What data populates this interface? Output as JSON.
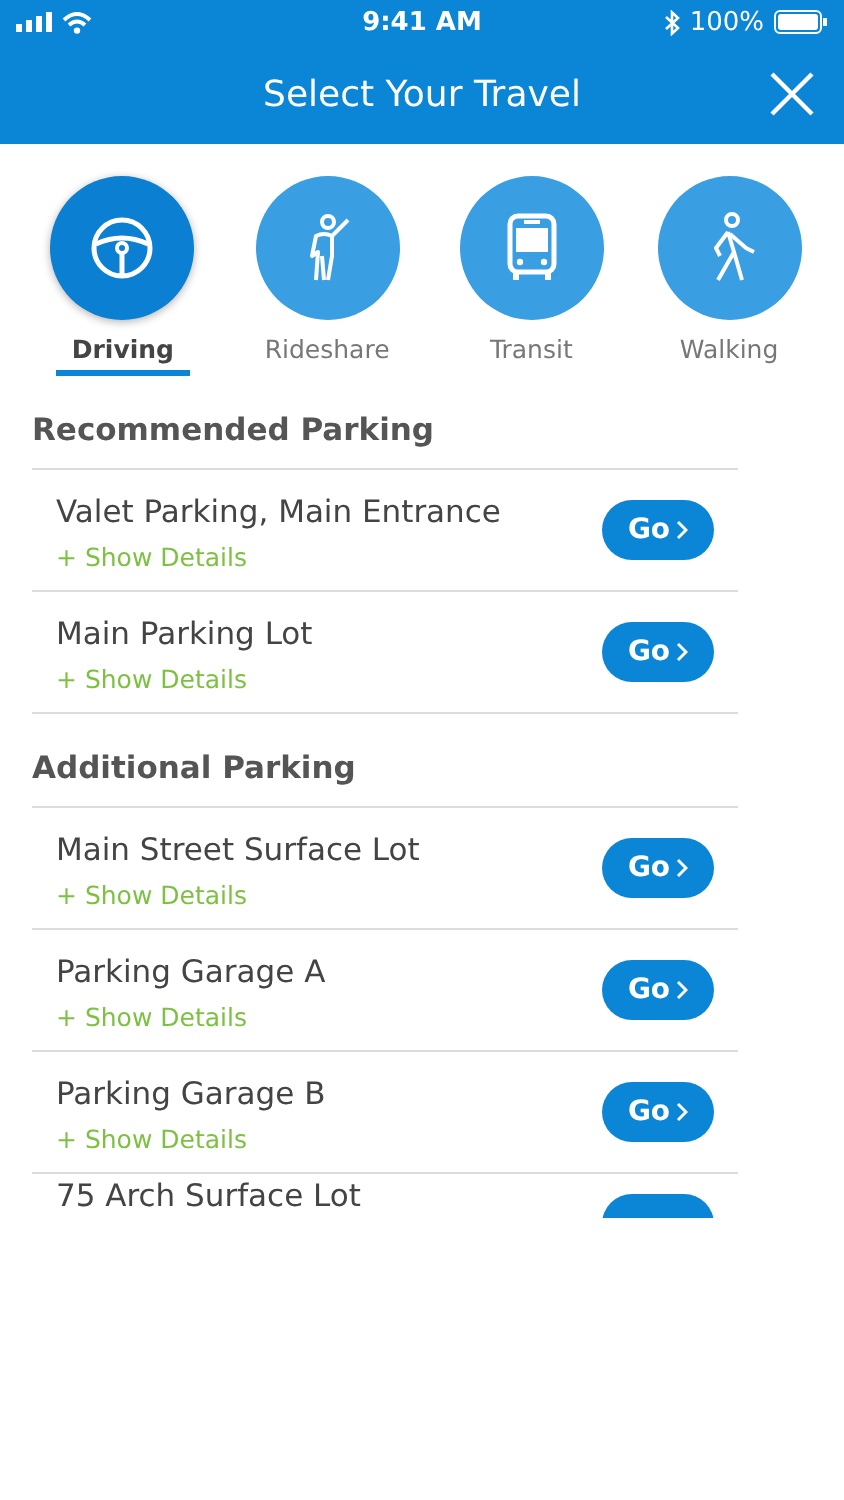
{
  "status_bar": {
    "time": "9:41 AM",
    "battery": "100%"
  },
  "header": {
    "title": "Select Your Travel"
  },
  "modes": [
    {
      "label": "Driving",
      "kind": "car",
      "selected": true
    },
    {
      "label": "Rideshare",
      "kind": "rideshare",
      "selected": false
    },
    {
      "label": "Transit",
      "kind": "transit",
      "selected": false
    },
    {
      "label": "Walking",
      "kind": "walking",
      "selected": false
    }
  ],
  "sections": [
    {
      "title": "Recommended Parking",
      "spots": [
        {
          "name": "Valet Parking, Main Entrance",
          "details": "+ Show Details",
          "button": "Go"
        },
        {
          "name": "Main Parking Lot",
          "details": "+ Show Details",
          "button": "Go"
        }
      ]
    },
    {
      "title": "Additional Parking",
      "spots": [
        {
          "name": "Main Street Surface Lot",
          "details": "+ Show Details",
          "button": "Go"
        },
        {
          "name": "Parking Garage A",
          "details": "+ Show Details",
          "button": "Go"
        },
        {
          "name": "Parking Garage B",
          "details": "+ Show Details",
          "button": "Go"
        },
        {
          "name": "75 Arch Surface Lot"
        }
      ]
    }
  ]
}
